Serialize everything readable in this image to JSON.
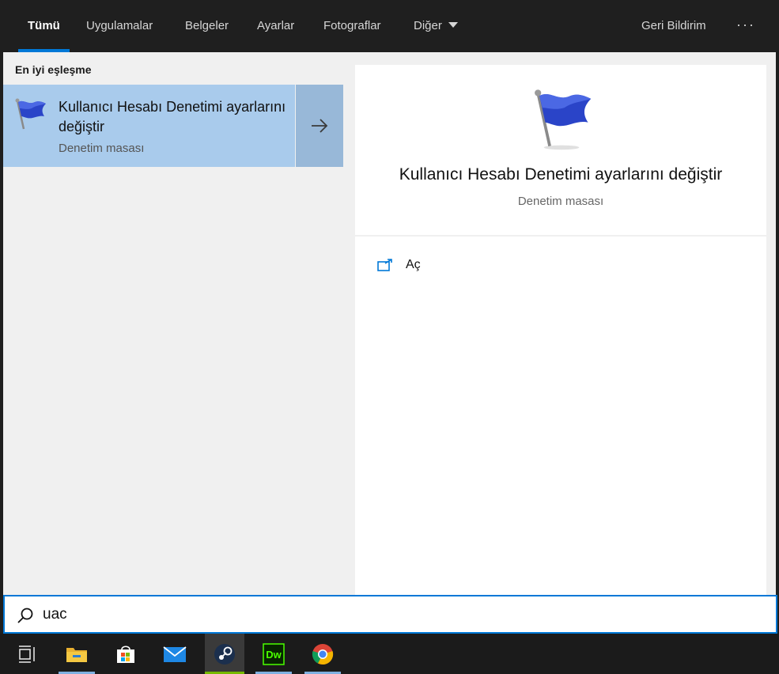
{
  "tabs": {
    "items": [
      {
        "label": "Tümü",
        "active": true
      },
      {
        "label": "Uygulamalar"
      },
      {
        "label": "Belgeler"
      },
      {
        "label": "Ayarlar"
      },
      {
        "label": "Fotograflar"
      },
      {
        "label": "Diğer"
      }
    ],
    "feedback_label": "Geri Bildirim",
    "more_label": "···"
  },
  "results": {
    "section_title": "En iyi eşleşme",
    "best": {
      "title": "Kullanıcı Hesabı Denetimi ayarlarını değiştir",
      "subtitle": "Denetim masası",
      "icon": "uac-flag-icon"
    }
  },
  "preview": {
    "title": "Kullanıcı Hesabı Denetimi ayarlarını değiştir",
    "subtitle": "Denetim masası",
    "icon": "uac-flag-icon",
    "actions": [
      {
        "label": "Aç",
        "icon": "open-icon"
      }
    ]
  },
  "search": {
    "value": "uac",
    "icon": "search-icon"
  },
  "taskbar": {
    "items": [
      {
        "icon": "task-view-icon"
      },
      {
        "icon": "file-explorer-icon"
      },
      {
        "icon": "microsoft-store-icon"
      },
      {
        "icon": "mail-icon"
      },
      {
        "icon": "steam-icon"
      },
      {
        "icon": "dreamweaver-icon",
        "label": "Dw"
      },
      {
        "icon": "chrome-icon"
      }
    ]
  },
  "colors": {
    "accent": "#0078d7",
    "selected_result": "#a9cbec",
    "tab_bar": "#1f1f1f"
  }
}
